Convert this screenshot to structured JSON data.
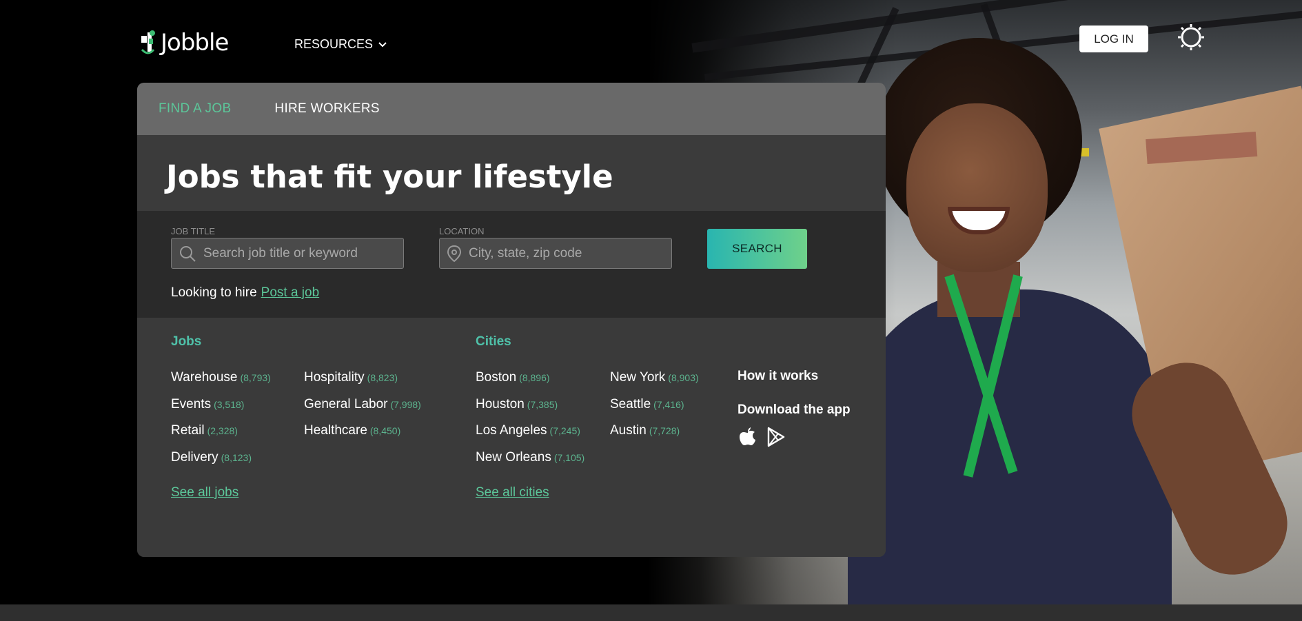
{
  "header": {
    "logo_text": "Jobble",
    "resources_label": "RESOURCES",
    "login_label": "LOG IN"
  },
  "tabs": [
    {
      "label": "FIND A JOB",
      "active": true
    },
    {
      "label": "HIRE WORKERS",
      "active": false
    }
  ],
  "headline": "Jobs that fit your lifestyle",
  "search": {
    "job_title_label": "JOB TITLE",
    "job_title_placeholder": "Search job title or keyword",
    "location_label": "LOCATION",
    "location_placeholder": "City, state, zip code",
    "search_button": "SEARCH",
    "hire_text": "Looking to hire",
    "post_job_link": "Post a job"
  },
  "jobs": {
    "title": "Jobs",
    "items": [
      {
        "label": "Warehouse",
        "count": "(8,793)"
      },
      {
        "label": "Events",
        "count": "(3,518)"
      },
      {
        "label": "Retail",
        "count": "(2,328)"
      },
      {
        "label": "Delivery",
        "count": "(8,123)"
      },
      {
        "label": "Hospitality",
        "count": "(8,823)"
      },
      {
        "label": "General Labor",
        "count": "(7,998)"
      },
      {
        "label": "Healthcare",
        "count": "(8,450)"
      }
    ],
    "see_all": "See all jobs"
  },
  "cities": {
    "title": "Cities",
    "items": [
      {
        "label": "Boston",
        "count": "(8,896)"
      },
      {
        "label": "Houston",
        "count": "(7,385)"
      },
      {
        "label": "Los Angeles",
        "count": "(7,245)"
      },
      {
        "label": "New Orleans",
        "count": "(7,105)"
      },
      {
        "label": "New York",
        "count": "(8,903)"
      },
      {
        "label": "Seattle",
        "count": "(7,416)"
      },
      {
        "label": "Austin",
        "count": "(7,728)"
      }
    ],
    "see_all": "See all cities"
  },
  "side": {
    "how_it_works": "How it works",
    "download_app": "Download the app"
  },
  "colors": {
    "accent_green": "#5cc79a",
    "teal": "#4fc1a9",
    "search_gradient_start": "#29b5b0",
    "search_gradient_end": "#6fd18a"
  },
  "icons": {
    "resources_chevron": "chevron-down-icon",
    "theme_toggle": "sun-icon",
    "job_title_field": "search-icon",
    "location_field": "location-pin-icon",
    "app_store": "apple-icon",
    "play_store": "google-play-icon"
  }
}
